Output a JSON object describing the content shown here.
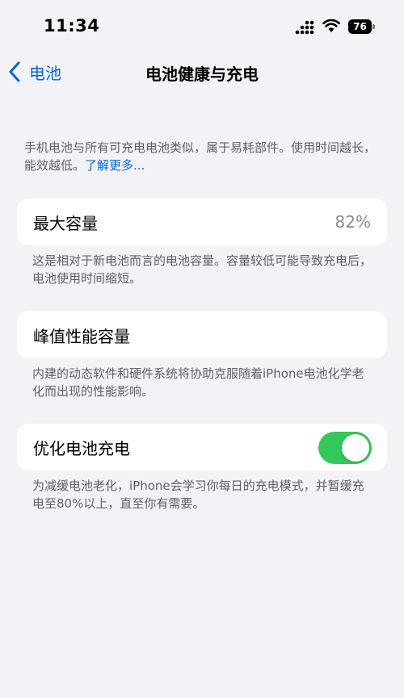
{
  "status_bar": {
    "time": "11:34",
    "battery_level": "76"
  },
  "nav": {
    "back_label": "电池",
    "title": "电池健康与充电"
  },
  "intro": {
    "text": "手机电池与所有可充电电池类似，属于易耗部件。使用时间越长，能效越低。",
    "link": "了解更多..."
  },
  "max_capacity": {
    "label": "最大容量",
    "value": "82%",
    "footnote": "这是相对于新电池而言的电池容量。容量较低可能导致充电后，电池使用时间缩短。"
  },
  "peak_performance": {
    "label": "峰值性能容量",
    "footnote": "内建的动态软件和硬件系统将协助克服随着iPhone电池化学老化而出现的性能影响。"
  },
  "optimized_charging": {
    "label": "优化电池充电",
    "enabled": true,
    "footnote": "为减缓电池老化，iPhone会学习你每日的充电模式，并暂缓充电至80%以上，直至你有需要。"
  },
  "colors": {
    "accent": "#0a63d6",
    "toggle_on": "#34c759",
    "background": "#f2f2f7"
  }
}
